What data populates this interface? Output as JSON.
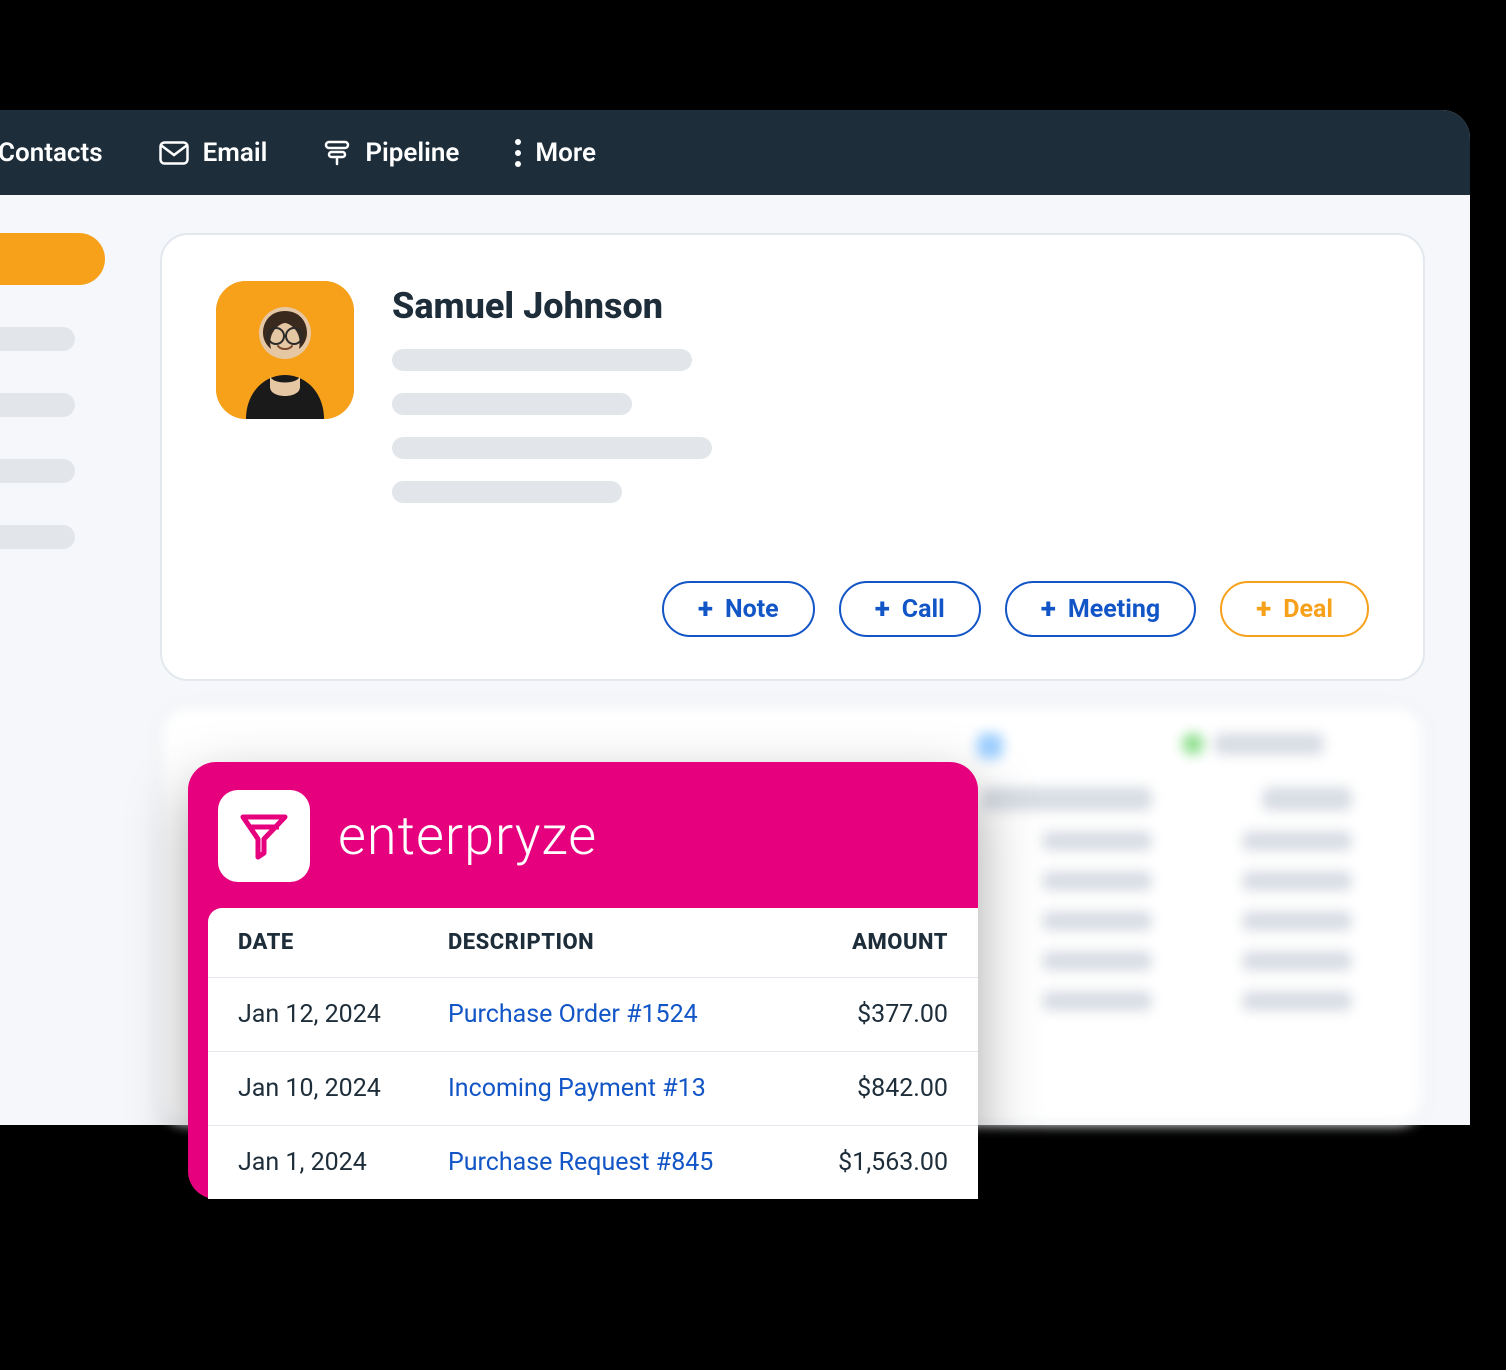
{
  "nav": {
    "items": [
      {
        "label": "Contacts"
      },
      {
        "label": "Email"
      },
      {
        "label": "Pipeline"
      },
      {
        "label": "More"
      }
    ]
  },
  "contact": {
    "name": "Samuel Johnson"
  },
  "actions": {
    "note": "Note",
    "call": "Call",
    "meeting": "Meeting",
    "deal": "Deal"
  },
  "widget": {
    "brand": "enterpryze",
    "columns": {
      "date": "DATE",
      "desc": "DESCRIPTION",
      "amount": "AMOUNT"
    },
    "rows": [
      {
        "date": "Jan 12, 2024",
        "desc": "Purchase Order #1524",
        "amount": "$377.00"
      },
      {
        "date": "Jan 10, 2024",
        "desc": "Incoming Payment #13",
        "amount": "$842.00"
      },
      {
        "date": "Jan 1, 2024",
        "desc": "Purchase Request #845",
        "amount": "$1,563.00"
      }
    ]
  }
}
